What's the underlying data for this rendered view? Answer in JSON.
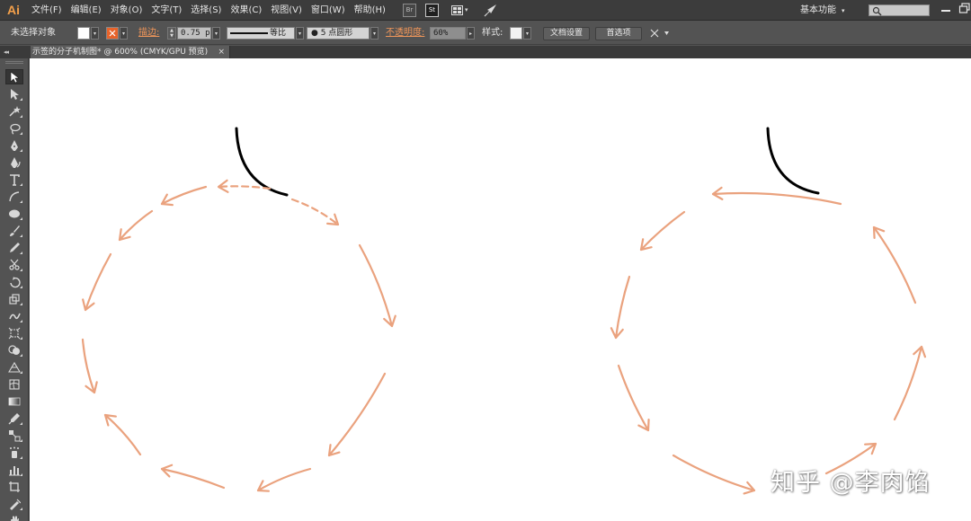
{
  "app": {
    "logo": "Ai"
  },
  "menubar": {
    "items": [
      {
        "name": "file",
        "label": "文件(F)"
      },
      {
        "name": "edit",
        "label": "编辑(E)"
      },
      {
        "name": "object",
        "label": "对象(O)"
      },
      {
        "name": "type",
        "label": "文字(T)"
      },
      {
        "name": "select",
        "label": "选择(S)"
      },
      {
        "name": "effect",
        "label": "效果(C)"
      },
      {
        "name": "view",
        "label": "视图(V)"
      },
      {
        "name": "window",
        "label": "窗口(W)"
      },
      {
        "name": "help",
        "label": "帮助(H)"
      }
    ],
    "bridge_label": "Br",
    "stock_label": "St",
    "workspace_label": "基本功能",
    "workspace_caret": "▾",
    "search_placeholder": ""
  },
  "controlbar": {
    "no_selection": "未选择对象",
    "fill_color": "#ffffff",
    "stroke_color": "#e8632a",
    "stroke_label": "描边:",
    "stroke_weight": "0.75 pt",
    "profile_label": "等比",
    "brush_label": "● 5 点圆形",
    "opacity_label": "不透明度:",
    "opacity_value": "60%",
    "style_label": "样式:",
    "doc_setup_label": "文档设置",
    "prefs_label": "首选项"
  },
  "tab": {
    "title": "示签的分子机制图* @ 600% (CMYK/GPU 预览)",
    "close": "×",
    "panel_collapse": "◂◂"
  },
  "tools": [
    "selection-tool",
    "direct-selection-tool",
    "magic-wand-tool",
    "lasso-tool",
    "pen-tool",
    "curvature-tool",
    "type-tool",
    "line-segment-tool",
    "ellipse-tool",
    "paintbrush-tool",
    "pencil-tool",
    "scissors-tool",
    "rotate-tool",
    "scale-tool",
    "warp-tool",
    "free-transform-tool",
    "shape-builder-tool",
    "perspective-grid-tool",
    "mesh-tool",
    "gradient-tool",
    "eyedropper-tool",
    "blend-tool",
    "symbol-sprayer-tool",
    "column-graph-tool",
    "artboard-tool",
    "slice-tool",
    "hand-tool"
  ],
  "canvas": {
    "arrow_color": "#eaa27e",
    "stroke_black": "#000000",
    "watermark": "知乎 @李肉馅"
  }
}
